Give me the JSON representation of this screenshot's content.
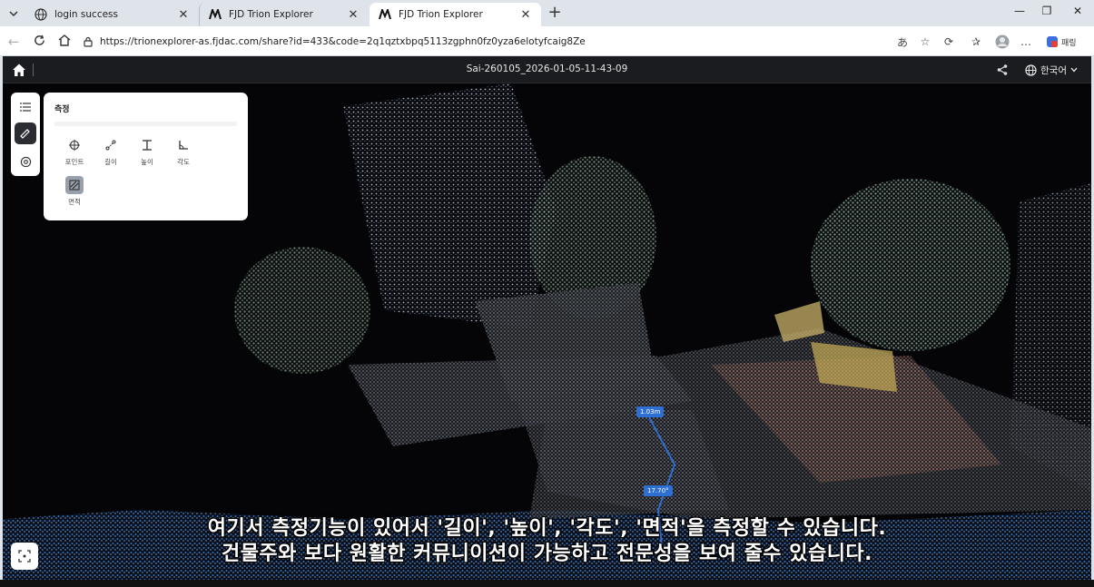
{
  "browser": {
    "tabs": [
      {
        "title": "login success",
        "icon": "globe-icon",
        "active": false
      },
      {
        "title": "FJD Trion Explorer",
        "icon": "fjd-logo-icon",
        "active": false
      },
      {
        "title": "FJD Trion Explorer",
        "icon": "fjd-logo-icon",
        "active": true
      }
    ],
    "url": "https://trionexplorer-as.fjdac.com/share?id=433&code=2q1qztxbpq5113zgphn0fz0yza6elotyfcaig8Ze",
    "profile_label": "패링"
  },
  "viewer": {
    "title": "Sai-260105_2026-01-05-11-43-09",
    "language": "한국어"
  },
  "measure_panel": {
    "title": "측정",
    "tools": [
      {
        "label": "포인트",
        "icon": "crosshair-icon"
      },
      {
        "label": "길이",
        "icon": "length-icon"
      },
      {
        "label": "높이",
        "icon": "height-icon"
      },
      {
        "label": "각도",
        "icon": "angle-icon"
      },
      {
        "label": "면적",
        "icon": "area-icon",
        "selected": true
      }
    ]
  },
  "measurements": {
    "length_tag": "1.03m",
    "angle_tag": "17.70°"
  },
  "subtitles": {
    "line1": "여기서 측정기능이 있어서 '길이', '높이', '각도', '면적'을 측정할 수 있습니다.",
    "line2": "건물주와 보다 원활한 커뮤니이션이 가능하고 전문성을 보여 줄수 있습니다."
  },
  "colors": {
    "accent": "#2d6fd2",
    "header_bg": "#1b1c20",
    "panel_bg": "#ffffff"
  }
}
